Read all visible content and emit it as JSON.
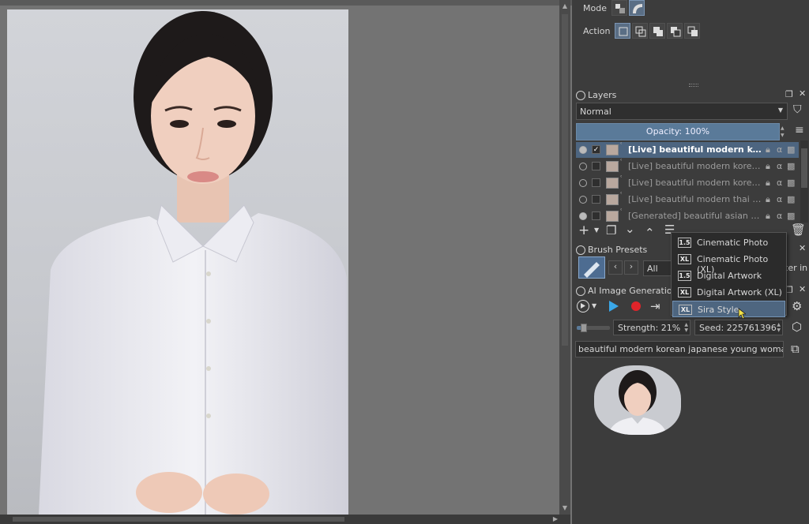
{
  "toolbar": {
    "mode_label": "Mode",
    "action_label": "Action"
  },
  "layers": {
    "title": "Layers",
    "blend_mode": "Normal",
    "opacity": "Opacity:  100%",
    "items": [
      {
        "name": "[Live] beautiful modern korea...",
        "selected": true,
        "visible": true
      },
      {
        "name": "[Live] beautiful modern korean ja...",
        "selected": false,
        "visible": false
      },
      {
        "name": "[Live] beautiful modern korean ja...",
        "selected": false,
        "visible": false
      },
      {
        "name": "[Live] beautiful modern thai youn...",
        "selected": false,
        "visible": false
      },
      {
        "name": "[Generated] beautiful asian woma...",
        "selected": false,
        "visible": true
      }
    ]
  },
  "brush_presets": {
    "title": "Brush Presets",
    "filter": "All",
    "filter_fragment": "ter in"
  },
  "ai_generation": {
    "title": "AI Image Generation",
    "strength": "Strength: 21%",
    "strength_fraction": 0.21,
    "seed": "Seed: 225761396",
    "prompt": "beautiful modern korean japanese young woman browi"
  },
  "style_menu": {
    "items": [
      {
        "badge": "1.5",
        "label": "Cinematic Photo",
        "active": false
      },
      {
        "badge": "XL",
        "label": "Cinematic Photo (XL)",
        "active": false
      },
      {
        "badge": "1.5",
        "label": "Digital Artwork",
        "active": false
      },
      {
        "badge": "XL",
        "label": "Digital Artwork (XL)",
        "active": false
      },
      {
        "badge": "XL",
        "label": "Sira Style",
        "active": true
      }
    ]
  },
  "colors": {
    "accent": "#5a7a99",
    "selection": "#4d6580",
    "panel_bg": "#3c3c3c",
    "canvas_bg": "#737373",
    "record": "#e0242a",
    "play": "#3aa7e8"
  }
}
